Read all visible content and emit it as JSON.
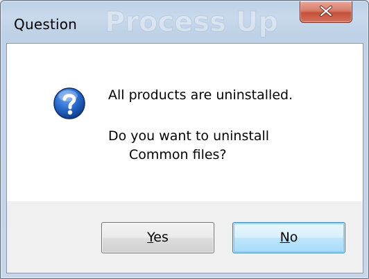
{
  "window": {
    "title": "Question",
    "watermark_text": "Process Up"
  },
  "message": {
    "line1": "All products are uninstalled.",
    "line2": "Do you want to uninstall",
    "line3": "Common files?"
  },
  "buttons": {
    "yes": {
      "label": "Yes",
      "mnemonic": "Y",
      "rest": "es"
    },
    "no": {
      "label": "No",
      "mnemonic": "N",
      "rest": "o"
    }
  },
  "icons": {
    "dialog_icon": "question-icon",
    "close": "close-icon"
  },
  "colors": {
    "frame": "#c7d6e8",
    "icon_blue": "#1f5fbf",
    "close_red": "#c4503a",
    "default_button_border": "#3c7fb1"
  }
}
